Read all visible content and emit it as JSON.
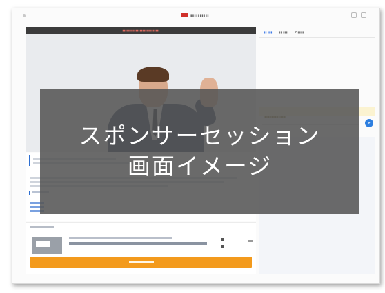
{
  "overlay": {
    "line1": "スポンサーセッション",
    "line2": "画面イメージ"
  },
  "colors": {
    "overlay": "#555555",
    "accent_blue": "#2e6fd1",
    "cta_orange": "#f39a1c",
    "banner_dark": "#3b3b3b"
  },
  "icons": [
    "send-icon",
    "brand-logo"
  ]
}
